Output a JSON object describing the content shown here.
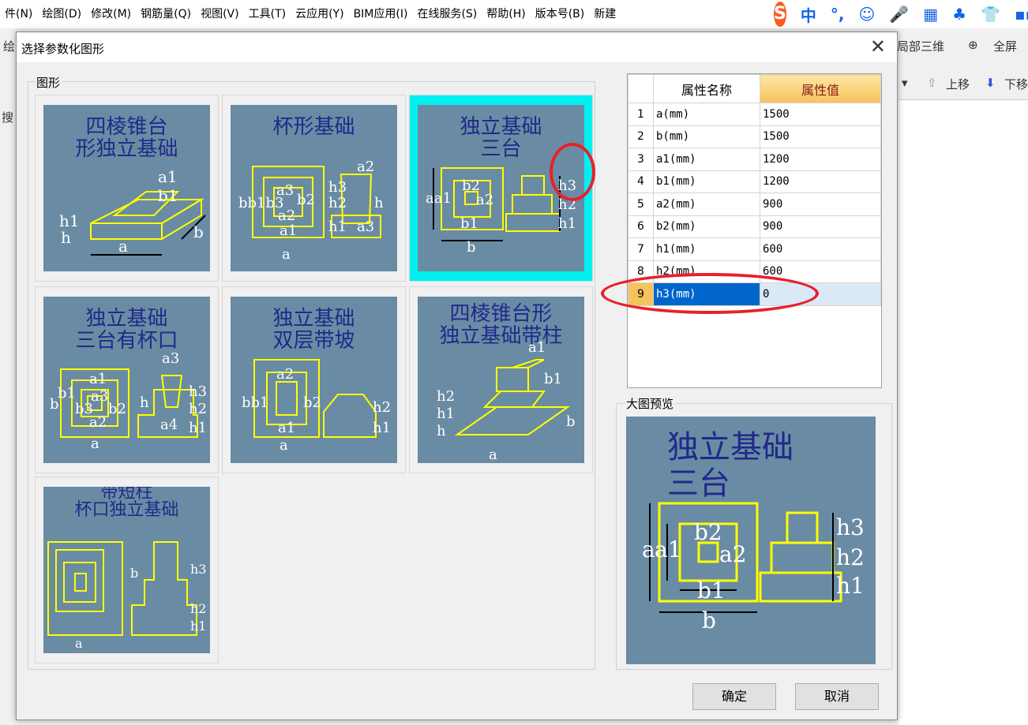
{
  "menubar": [
    "件(N)",
    "绘图(D)",
    "修改(M)",
    "钢筋量(Q)",
    "视图(V)",
    "工具(T)",
    "云应用(Y)",
    "BIM应用(I)",
    "在线服务(S)",
    "帮助(H)",
    "版本号(B)",
    "新建"
  ],
  "ime": {
    "logo": "S",
    "items": [
      "中",
      "°,",
      "☺",
      "🎤",
      "▦",
      "♣",
      "👕",
      "▪▪"
    ]
  },
  "background": {
    "left_label": "绘",
    "search_label": "搜",
    "toolbar_right": [
      "局部三维",
      "全屏"
    ],
    "toolbar_right2": [
      "上移",
      "下移"
    ]
  },
  "dialog": {
    "title": "选择参数化图形",
    "shapes_legend": "图形",
    "preview_legend": "大图预览",
    "ok_label": "确定",
    "cancel_label": "取消"
  },
  "tiles": [
    {
      "title": "四棱锥台\n形独立基础",
      "selected": false
    },
    {
      "title": "杯形基础",
      "selected": false
    },
    {
      "title": "独立基础\n三台",
      "selected": true
    },
    {
      "title": "独立基础\n三台有杯口",
      "selected": false
    },
    {
      "title": "独立基础\n双层带坡",
      "selected": false
    },
    {
      "title": "四棱锥台形\n独立基础带柱",
      "selected": false
    },
    {
      "title": "带短柱\n杯口独立基础",
      "selected": false
    }
  ],
  "propgrid": {
    "header_name": "属性名称",
    "header_value": "属性值",
    "rows": [
      {
        "num": "1",
        "name": "a(mm)",
        "value": "1500"
      },
      {
        "num": "2",
        "name": "b(mm)",
        "value": "1500"
      },
      {
        "num": "3",
        "name": "a1(mm)",
        "value": "1200"
      },
      {
        "num": "4",
        "name": "b1(mm)",
        "value": "1200"
      },
      {
        "num": "5",
        "name": "a2(mm)",
        "value": "900"
      },
      {
        "num": "6",
        "name": "b2(mm)",
        "value": "900"
      },
      {
        "num": "7",
        "name": "h1(mm)",
        "value": "600"
      },
      {
        "num": "8",
        "name": "h2(mm)",
        "value": "600"
      },
      {
        "num": "9",
        "name": "h3(mm)",
        "value": "0"
      }
    ],
    "selected_row": 9
  },
  "preview": {
    "title_line1": "独立基础",
    "title_line2": "三台",
    "labels": [
      "a",
      "a1",
      "b2",
      "a2",
      "b1",
      "b",
      "h3",
      "h2",
      "h1"
    ]
  },
  "colors": {
    "drawing_bg": "#6a8ba4",
    "drawing_line": "#ffff00",
    "title_text": "#1f2a8a",
    "selection": "#00f0f0",
    "annotation": "#e8202a"
  }
}
